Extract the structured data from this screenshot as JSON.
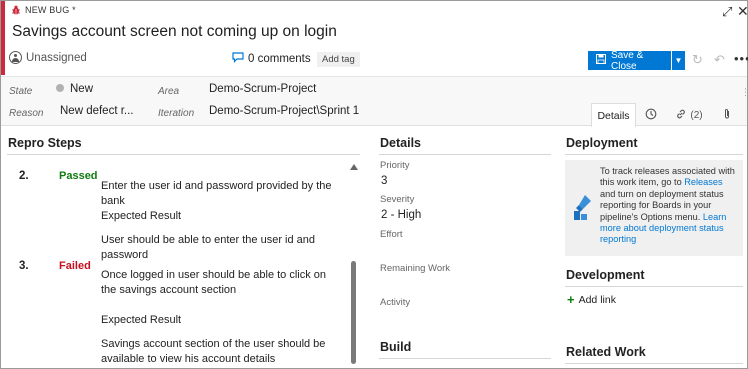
{
  "header": {
    "type_label": "NEW BUG *",
    "title": "Savings account screen not coming up on login",
    "assignee": "Unassigned",
    "comments": "0 comments",
    "add_tag": "Add tag",
    "save_close": "Save & Close",
    "more": "•••"
  },
  "fields": {
    "state_label": "State",
    "state_value": "New",
    "reason_label": "Reason",
    "reason_value": "New defect r...",
    "area_label": "Area",
    "area_value": "Demo-Scrum-Project",
    "iteration_label": "Iteration",
    "iteration_value": "Demo-Scrum-Project\\Sprint 1"
  },
  "tabs": {
    "details": "Details",
    "links_count": "(2)"
  },
  "repro": {
    "title": "Repro Steps",
    "steps": [
      {
        "num": "2.",
        "status": "Passed",
        "action": "Enter the user id and password provided by the bank",
        "expected_label": "Expected Result",
        "expected": "User should be able to enter the user id and password"
      },
      {
        "num": "3.",
        "status": "Failed",
        "action": "Once logged in user should be able to click on the savings account section",
        "expected_label": "Expected Result",
        "expected": "Savings account section of the user should be available to view his account details"
      }
    ]
  },
  "details": {
    "title": "Details",
    "priority_label": "Priority",
    "priority_value": "3",
    "severity_label": "Severity",
    "severity_value": "2 - High",
    "effort_label": "Effort",
    "remaining_label": "Remaining Work",
    "activity_label": "Activity",
    "build_title": "Build"
  },
  "deployment": {
    "title": "Deployment",
    "text_1": "To track releases associated with this work item, go to ",
    "releases_link": "Releases",
    "text_2": " and turn on deployment status reporting for Boards in your pipeline's Options menu. ",
    "learn_link": "Learn more about deployment status reporting"
  },
  "development": {
    "title": "Development",
    "add_link": "Add link"
  },
  "related_work": {
    "title": "Related Work"
  },
  "colors": {
    "bug_accent": "#cc293d",
    "primary_button": "#0078d4",
    "passed": "#107c10",
    "failed": "#c50f1f"
  }
}
